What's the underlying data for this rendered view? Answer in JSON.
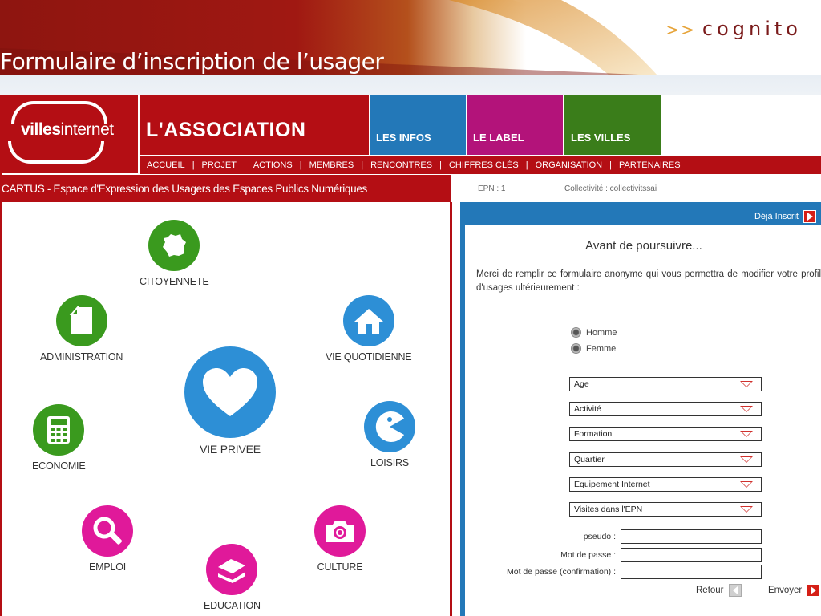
{
  "slide": {
    "brand_arrows": ">>",
    "brand": "cognito",
    "title": "Formulaire d’inscription de l’usager"
  },
  "site": {
    "logo": {
      "bold": "villes",
      "light": "internet"
    },
    "association_title": "L'ASSOCIATION",
    "category_tabs": [
      {
        "label": "LES INFOS",
        "color": "#2378b8"
      },
      {
        "label": "LE LABEL",
        "color": "#b3137a"
      },
      {
        "label": "LES VILLES",
        "color": "#3a7d1a"
      }
    ],
    "nav": [
      "ACCUEIL",
      "PROJET",
      "ACTIONS",
      "MEMBRES",
      "RENCONTRES",
      "CHIFFRES CLÉS",
      "ORGANISATION",
      "PARTENAIRES"
    ],
    "nav_separator": "|",
    "subtitle": "CARTUS - Espace d'Expression des Usagers des Espaces Publics Numériques",
    "categories": [
      {
        "label": "CITOYENNETE",
        "icon": "france-map-icon",
        "color": "#3a9a1e"
      },
      {
        "label": "ADMINISTRATION",
        "icon": "document-icon",
        "color": "#3a9a1e"
      },
      {
        "label": "VIE QUOTIDIENNE",
        "icon": "house-icon",
        "color": "#2d8fd6"
      },
      {
        "label": "VIE PRIVEE",
        "icon": "heart-icon",
        "color": "#2d8fd6"
      },
      {
        "label": "ECONOMIE",
        "icon": "calculator-icon",
        "color": "#3a9a1e"
      },
      {
        "label": "LOISIRS",
        "icon": "pacman-icon",
        "color": "#2d8fd6"
      },
      {
        "label": "EMPLOI",
        "icon": "magnifier-icon",
        "color": "#e0199a"
      },
      {
        "label": "CULTURE",
        "icon": "camera-icon",
        "color": "#e0199a"
      },
      {
        "label": "EDUCATION",
        "icon": "books-icon",
        "color": "#e0199a"
      }
    ],
    "info": {
      "epn": "EPN : 1",
      "collectivite": "Collectivité : collectivitssai"
    },
    "form": {
      "already_registered": "Déjà Inscrit",
      "title": "Avant de poursuivre...",
      "intro": "Merci de remplir ce formulaire anonyme qui vous permettra de modifier votre profil d'usages ultérieurement :",
      "gender": [
        "Homme",
        "Femme"
      ],
      "selects": [
        "Age",
        "Activité",
        "Formation",
        "Quartier",
        "Equipement Internet",
        "Visites dans l'EPN"
      ],
      "fields": [
        "pseudo  :",
        "Mot de passe  :",
        "Mot de passe (confirmation) :"
      ],
      "back": "Retour",
      "send": "Envoyer"
    }
  }
}
